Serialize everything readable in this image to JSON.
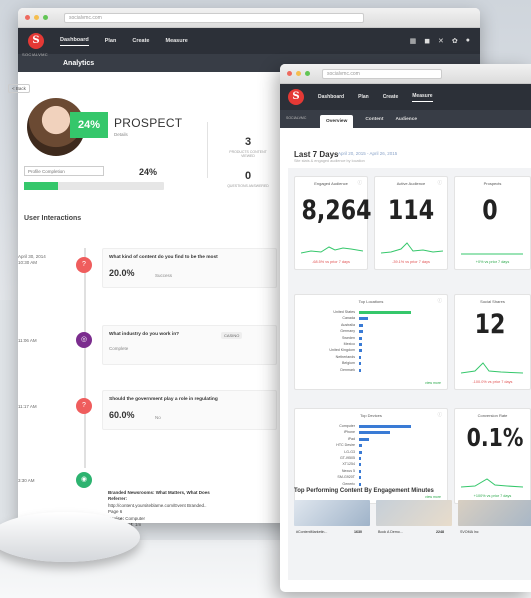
{
  "back_window": {
    "url": "socialvmc.com",
    "brand": "S",
    "brand_sub": "SOCIALVMC",
    "nav": [
      "Dashboard",
      "Plan",
      "Create",
      "Measure"
    ],
    "section_title": "Analytics",
    "back_label": "< Back",
    "profile": {
      "score_badge": "24%",
      "status": "PROSPECT",
      "status_sub": "Details",
      "stat1_value": "3",
      "stat1_label": "PRODUCTS CONTENT VIEWED",
      "stat2_value": "0",
      "stat2_label": "QUESTIONS ANSWERED",
      "completion_label": "Profile Completion",
      "completion_value": "24%",
      "completion_fraction": 0.24
    },
    "interactions_title": "User Interactions",
    "timeline": [
      {
        "date": "April 30, 2014\n10:30 AM",
        "icon": "question-icon",
        "color": "#ef5d5d",
        "question": "What kind of content do you find to be the most",
        "answer": "20.0%",
        "answer_sub": "Success"
      },
      {
        "date": "11:06 AM",
        "icon": "target-icon",
        "color": "#7b2d8e",
        "question": "What industry do you work in?",
        "chip": "CASINO",
        "answer_sub": "Complete"
      },
      {
        "date": "11:17 AM",
        "icon": "question-icon",
        "color": "#ef5d5d",
        "question": "Should the government play a role in regulating",
        "answer": "60.0%",
        "answer_sub": "No"
      },
      {
        "date": "3:30 AM",
        "icon": "eye-icon",
        "color": "#2db370",
        "title": "Branded Newsrooms: What Matters, What Does",
        "referrer_label": "Referrer:",
        "referrer_value": "http://content.yoursiteblame.com/Event Branded..",
        "page": "Page 6",
        "device_label": "Device:",
        "device_value": "Computer",
        "time_label": "Time Spent:",
        "time_value": "1m"
      }
    ]
  },
  "front_window": {
    "url": "socialvmc.com",
    "brand": "S",
    "brand_sub": "SOCIALVMC",
    "nav": [
      "Dashboard",
      "Plan",
      "Create",
      "Measure"
    ],
    "tabs": [
      "Overview",
      "Content",
      "Audience"
    ],
    "period_title": "Last 7 Days",
    "period_range": "April 20, 2015 - April 26, 2015",
    "period_sub": "Site stats & engaged audience by location",
    "cards": [
      {
        "title": "Engaged Audience",
        "value": "8,264",
        "foot": "-68.5% vs prior 7 days",
        "foot_color": "#e05050"
      },
      {
        "title": "Active Audience",
        "value": "114",
        "foot": "-39.1% vs prior 7 days",
        "foot_color": "#e05050"
      },
      {
        "title": "Prospects",
        "value": "0",
        "foot": "+0% vs prior 7 days",
        "foot_color": "#2aa84a"
      },
      {
        "title": "Social Shares",
        "value": "12",
        "foot": "-100.0% vs prior 7 days",
        "foot_color": "#e05050"
      },
      {
        "title": "Conversion Rate",
        "value": "0.1%",
        "foot": "+100% vs prior 7 days",
        "foot_color": "#2aa84a"
      }
    ],
    "top_locations": {
      "title": "Top Locations",
      "items": [
        "United States",
        "Canada",
        "Australia",
        "Germany",
        "Sweden",
        "Mexico",
        "United Kingdom",
        "Netherlands",
        "Belgium",
        "Denmark"
      ],
      "values": [
        100,
        18,
        8,
        7,
        6,
        5,
        5,
        4,
        3,
        3
      ],
      "view_more": "view more"
    },
    "top_devices": {
      "title": "Top Devices",
      "items": [
        "Computer",
        "iPhone",
        "iPad",
        "HTC Desire",
        "LG-G3",
        "GT-I9505",
        "XT1254",
        "Nexus 5",
        "SM-G920T",
        "Generic"
      ],
      "values": [
        100,
        60,
        20,
        6,
        5,
        4,
        4,
        3,
        3,
        3
      ],
      "view_more": "view more"
    },
    "top_content_title": "Top Performing Content By Engagement Minutes",
    "top_content": [
      {
        "caption": "#ContentMarketin...",
        "value": "1630",
        "color_a": "#dfe6ee",
        "color_b": "#9fb3c9"
      },
      {
        "caption": "Book A Demo...",
        "value": "2248",
        "color_a": "#c6cfd8",
        "color_b": "#e8dccb"
      },
      {
        "caption": "SVOMA Inc",
        "value": "",
        "color_a": "#d8cfc2",
        "color_b": "#a7b6c6"
      }
    ]
  },
  "colors": {
    "accent_red": "#e53935",
    "accent_green": "#35c76b",
    "nav_dark": "#2c3038",
    "bar_blue": "#3a7bd5"
  }
}
